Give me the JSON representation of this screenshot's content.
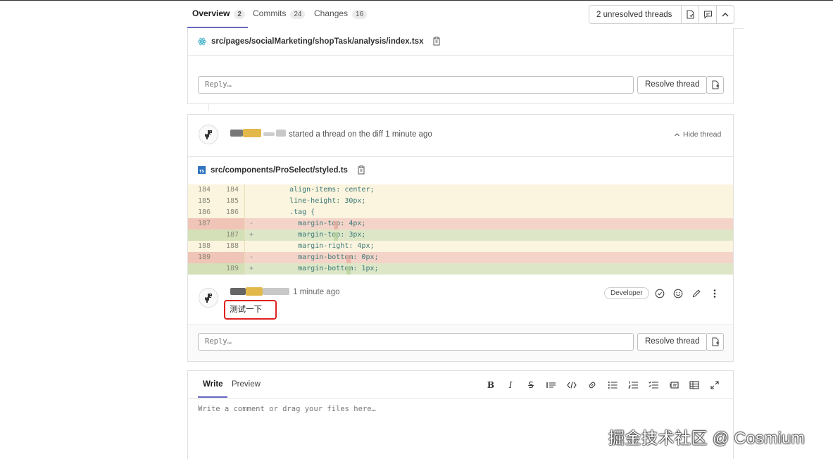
{
  "tabs": [
    {
      "label": "Overview",
      "count": "2"
    },
    {
      "label": "Commits",
      "count": "24"
    },
    {
      "label": "Changes",
      "count": "16"
    }
  ],
  "threads_button": {
    "label": "2 unresolved threads"
  },
  "thread1": {
    "file_path": "src/pages/socialMarketing/shopTask/analysis/index.tsx",
    "reply_placeholder": "Reply…",
    "resolve_label": "Resolve thread"
  },
  "thread2": {
    "header_text": "started a thread on the diff 1 minute ago",
    "hide_label": "Hide thread",
    "file_path": "src/components/ProSelect/styled.ts",
    "diff": [
      {
        "old": "184",
        "new": "184",
        "mark": "",
        "type": "ctx",
        "code": "    align-items: center;"
      },
      {
        "old": "185",
        "new": "185",
        "mark": "",
        "type": "ctx",
        "code": "    line-height: 30px;"
      },
      {
        "old": "186",
        "new": "186",
        "mark": "",
        "type": "ctx",
        "code": "    .tag {"
      },
      {
        "old": "187",
        "new": "",
        "mark": "-",
        "type": "del",
        "code": "      margin-top: 4px;"
      },
      {
        "old": "",
        "new": "187",
        "mark": "+",
        "type": "add",
        "code": "      margin-top: 3px;"
      },
      {
        "old": "188",
        "new": "188",
        "mark": "",
        "type": "ctx",
        "code": "      margin-right: 4px;"
      },
      {
        "old": "189",
        "new": "",
        "mark": "-",
        "type": "del",
        "code": "      margin-bottom: 0px;"
      },
      {
        "old": "",
        "new": "189",
        "mark": "+",
        "type": "add",
        "code": "      margin-bottom: 1px;"
      }
    ],
    "comment_time": "1 minute ago",
    "role_badge": "Developer",
    "comment_body": "测试一下",
    "reply_placeholder": "Reply…",
    "resolve_label": "Resolve thread"
  },
  "editor": {
    "tab_write": "Write",
    "tab_preview": "Preview",
    "placeholder": "Write a comment or drag your files here…"
  },
  "watermark": "掘金技术社区 @ Cosmium",
  "colors": {
    "accent": "#6666c4",
    "highlight_box": "#e02020"
  }
}
